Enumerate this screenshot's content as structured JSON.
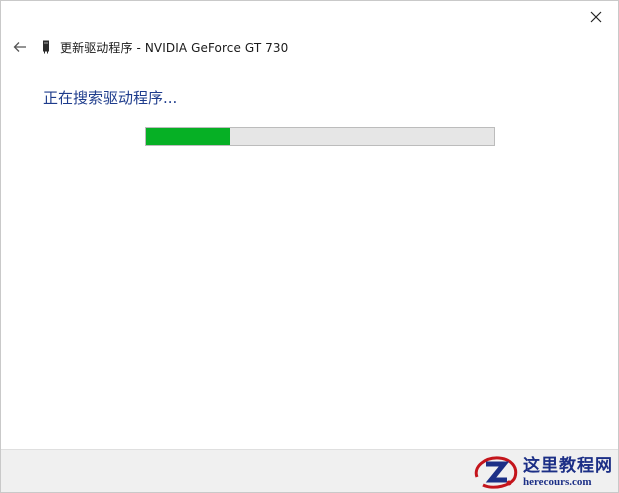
{
  "window": {
    "title": "更新驱动程序 - NVIDIA GeForce GT 730",
    "close_icon": "close-icon",
    "back_icon": "back-arrow-icon",
    "device_icon": "graphics-card-icon"
  },
  "main": {
    "status_text": "正在搜索驱动程序...",
    "progress_percent": 24
  },
  "watermark": {
    "text_cn": "这里教程网",
    "text_en": "herecours.com"
  },
  "colors": {
    "status_text": "#1e3c8c",
    "progress_fill": "#06b025",
    "progress_track": "#e6e6e6",
    "footer_bg": "#f0f0f0"
  }
}
